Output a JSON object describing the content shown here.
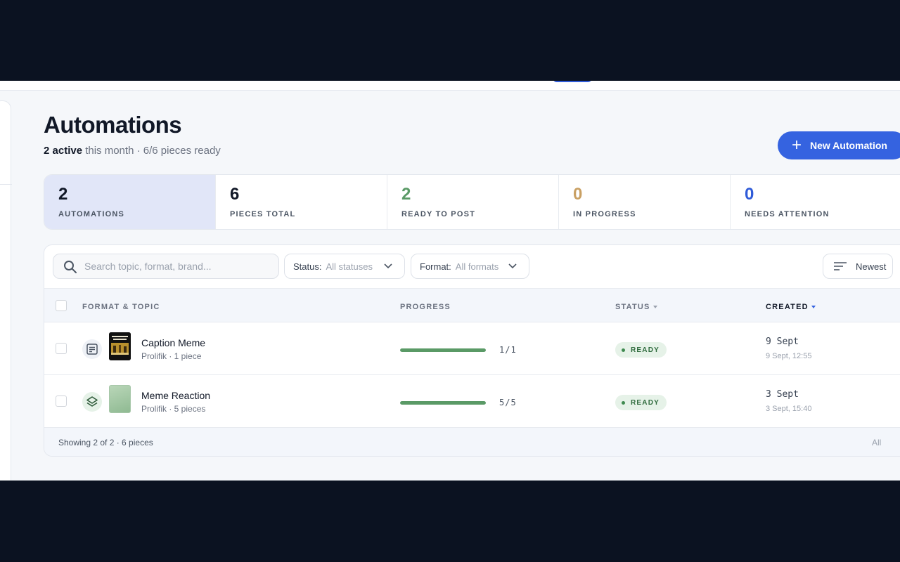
{
  "page": {
    "title": "Automations",
    "subtitle_strong": "2 active",
    "subtitle_rest": " this month · 6/6 pieces ready",
    "new_button_label": "New Automation"
  },
  "colors": {
    "accent": "#3563e0",
    "ready_green": "#5a9a66",
    "in_progress_amber": "#c9a063",
    "needs_attention_blue": "#2f5bd8"
  },
  "stats": [
    {
      "value": "2",
      "label": "AUTOMATIONS",
      "color": "#111827",
      "active": true
    },
    {
      "value": "6",
      "label": "PIECES TOTAL",
      "color": "#111827",
      "active": false
    },
    {
      "value": "2",
      "label": "READY TO POST",
      "color": "#5a9a66",
      "active": false
    },
    {
      "value": "0",
      "label": "IN PROGRESS",
      "color": "#c9a063",
      "active": false
    },
    {
      "value": "0",
      "label": "NEEDS ATTENTION",
      "color": "#2f5bd8",
      "active": false
    }
  ],
  "toolbar": {
    "search_placeholder": "Search topic, format, brand...",
    "status_label": "Status:",
    "status_value": "All statuses",
    "format_label": "Format:",
    "format_value": "All formats",
    "sort_label": "Newest"
  },
  "table": {
    "headers": {
      "format_topic": "FORMAT & TOPIC",
      "progress": "PROGRESS",
      "status": "STATUS",
      "created": "CREATED"
    },
    "rows": [
      {
        "title": "Caption Meme",
        "subtitle": "Prolifik · 1 piece",
        "format_icon": "caption-icon",
        "progress_text": "1/1",
        "progress_fraction": 1.0,
        "status": "READY",
        "created_main": "9 Sept",
        "created_sub": "9 Sept, 12:55"
      },
      {
        "title": "Meme Reaction",
        "subtitle": "Prolifik · 5 pieces",
        "format_icon": "layers-icon",
        "progress_text": "5/5",
        "progress_fraction": 1.0,
        "status": "READY",
        "created_main": "3 Sept",
        "created_sub": "3 Sept, 15:40"
      }
    ],
    "footer_text": "Showing 2 of 2 · 6 pieces",
    "footer_all": "All"
  }
}
